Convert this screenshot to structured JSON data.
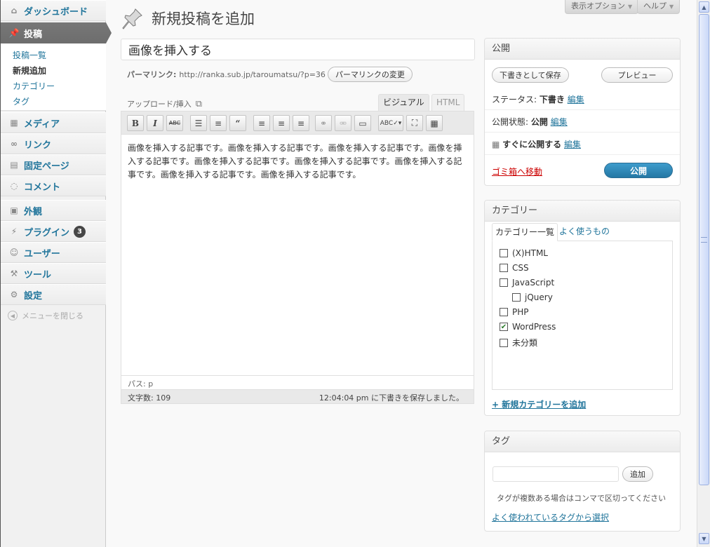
{
  "menu": {
    "dashboard": "ダッシュボード",
    "posts": "投稿",
    "sub": [
      "投稿一覧",
      "新規追加",
      "カテゴリー",
      "タグ"
    ],
    "media": "メディア",
    "links": "リンク",
    "pages": "固定ページ",
    "comments": "コメント",
    "appearance": "外観",
    "plugins": "プラグイン",
    "plugins_badge": "3",
    "users": "ユーザー",
    "tools": "ツール",
    "settings": "設定",
    "collapse": "メニューを閉じる"
  },
  "header": {
    "title": "新規投稿を追加",
    "screen_options": "表示オプション",
    "help": "ヘルプ"
  },
  "post": {
    "title": "画像を挿入する",
    "permalink_label": "パーマリンク:",
    "permalink_url": "http://ranka.sub.jp/taroumatsu/?p=36",
    "permalink_button": "パーマリンクの変更"
  },
  "editor": {
    "upload_label": "アップロード/挿入",
    "tab_visual": "ビジュアル",
    "tab_html": "HTML",
    "content": "画像を挿入する記事です。画像を挿入する記事です。画像を挿入する記事です。画像を挿入する記事です。画像を挿入する記事です。画像を挿入する記事です。画像を挿入する記事です。画像を挿入する記事です。画像を挿入する記事です。",
    "path": "パス: p",
    "word_count": "文字数: 109",
    "autosave": "12:04:04 pm に下書きを保存しました。"
  },
  "publish": {
    "title": "公開",
    "save_draft": "下書きとして保存",
    "preview": "プレビュー",
    "status_label": "ステータス:",
    "status_value": "下書き",
    "visibility_label": "公開状態:",
    "visibility_value": "公開",
    "schedule_label": "すぐに公開する",
    "edit": "編集",
    "trash": "ゴミ箱へ移動",
    "publish_button": "公開"
  },
  "categories": {
    "title": "カテゴリー",
    "tab_all": "カテゴリー一覧",
    "tab_popular": "よく使うもの",
    "items": [
      {
        "label": "(X)HTML",
        "checked": false
      },
      {
        "label": "CSS",
        "checked": false
      },
      {
        "label": "JavaScript",
        "checked": false
      },
      {
        "label": "jQuery",
        "checked": false
      },
      {
        "label": "PHP",
        "checked": false
      },
      {
        "label": "WordPress",
        "checked": true
      },
      {
        "label": "未分類",
        "checked": false
      }
    ],
    "add_new": "+ 新規カテゴリーを追加"
  },
  "tags": {
    "title": "タグ",
    "add_button": "追加",
    "hint": "タグが複数ある場合はコンマで区切ってください",
    "popular_link": "よく使われているタグから選択"
  },
  "colors": {
    "link": "#21759b",
    "primary": "#2477a4",
    "trash": "#cc0000"
  }
}
